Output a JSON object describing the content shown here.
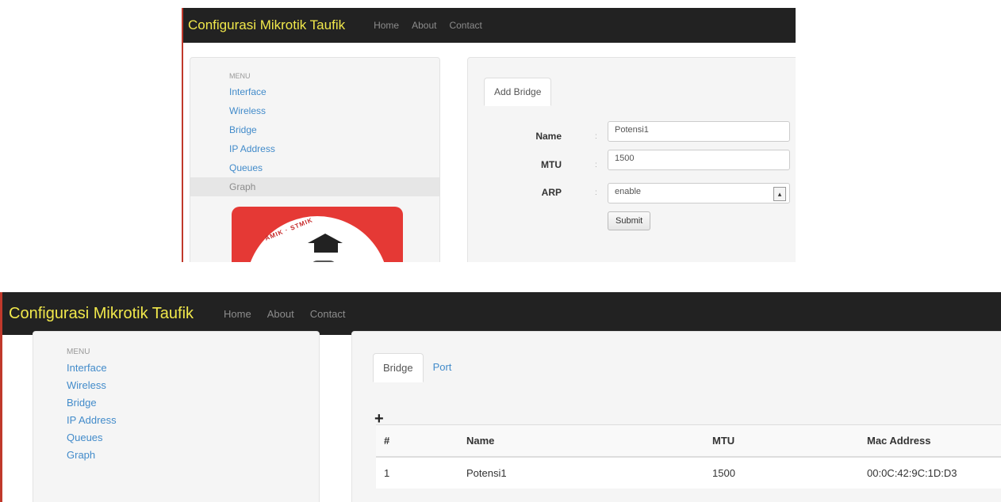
{
  "add_bridge_view": {
    "brand": "Configurasi Mikrotik Taufik",
    "nav": [
      "Home",
      "About",
      "Contact"
    ],
    "sidebar": {
      "header": "MENU",
      "items": [
        "Interface",
        "Wireless",
        "Bridge",
        "IP Address",
        "Queues",
        "Graph"
      ],
      "active_item": "Graph"
    },
    "tab": "Add Bridge",
    "form": {
      "name_label": "Name",
      "name_value": "Potensi1",
      "mtu_label": "MTU",
      "mtu_value": "1500",
      "arp_label": "ARP",
      "arp_value": "enable",
      "colon": ":",
      "submit_label": "Submit"
    }
  },
  "bridge_list_view": {
    "brand": "Configurasi Mikrotik Taufik",
    "nav": [
      "Home",
      "About",
      "Contact"
    ],
    "sidebar": {
      "header": "MENU",
      "items": [
        "Interface",
        "Wireless",
        "Bridge",
        "IP Address",
        "Queues",
        "Graph"
      ]
    },
    "tabs": [
      "Bridge",
      "Port"
    ],
    "add_icon": "+",
    "table": {
      "columns": [
        "#",
        "Name",
        "MTU",
        "Mac Address"
      ],
      "rows": [
        [
          "1",
          "Potensi1",
          "1500",
          "00:0C:42:9C:1D:D3"
        ]
      ]
    }
  }
}
